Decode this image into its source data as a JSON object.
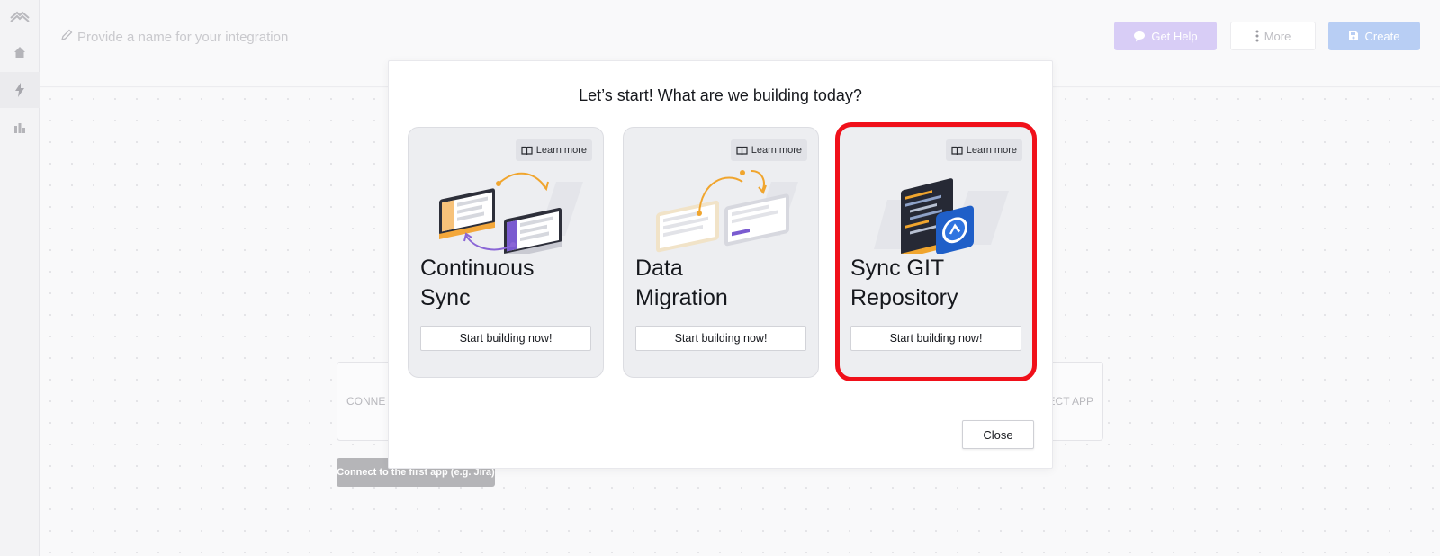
{
  "header": {
    "name_placeholder": "Provide a name for your integration",
    "help_label": "Get Help",
    "more_label": "More",
    "create_label": "Create"
  },
  "sidebar": {
    "items": [
      {
        "icon": "logo-icon"
      },
      {
        "icon": "home-icon"
      },
      {
        "icon": "bolt-icon",
        "active": true
      },
      {
        "icon": "chart-icon"
      }
    ]
  },
  "canvas": {
    "connect_left": "CONNE",
    "connect_right": "ECT APP",
    "hint": "Connect to the first app (e.g. Jira)"
  },
  "modal": {
    "title": "Let’s start! What are we building today?",
    "cards": [
      {
        "title": "Continuous\nSync",
        "learn_more": "Learn more",
        "button": "Start building now!"
      },
      {
        "title": "Data\nMigration",
        "learn_more": "Learn more",
        "button": "Start building now!"
      },
      {
        "title": "Sync GIT\nRepository",
        "learn_more": "Learn more",
        "button": "Start building now!",
        "highlighted": true
      }
    ],
    "close_label": "Close"
  },
  "colors": {
    "highlight": "#f0101a",
    "help_button": "#d8cdf6",
    "create_button": "#b8cef4"
  }
}
